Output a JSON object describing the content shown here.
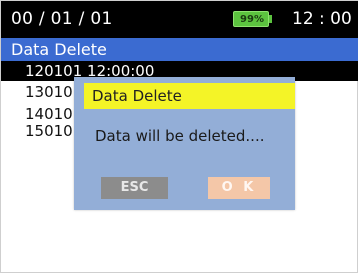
{
  "status_bar": {
    "date": "00 / 01 / 01",
    "battery": "99%",
    "time": "12 : 00"
  },
  "screen_title": "Data Delete",
  "records": [
    {
      "label": "120101 12:00:00"
    },
    {
      "label": "13010"
    },
    {
      "label": "14010"
    },
    {
      "label": "15010"
    }
  ],
  "dialog": {
    "title": "Data Delete",
    "message": "Data will be deleted....",
    "esc_label": "ESC",
    "ok_label": "O K"
  },
  "colors": {
    "title_bar": "#3b6bd1",
    "dialog_bg": "#93aed7",
    "dialog_title": "#f4f427",
    "battery": "#5cc33f"
  }
}
